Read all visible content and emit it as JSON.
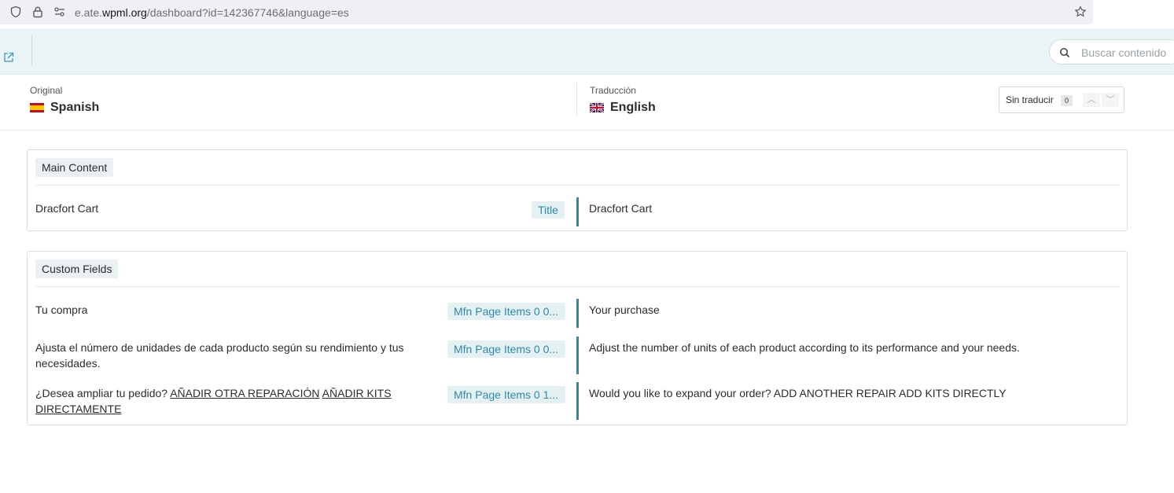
{
  "browser": {
    "url_prefix": "e.ate.",
    "url_domain": "wpml.org",
    "url_suffix": "/dashboard?id=142367746&language=es"
  },
  "toolbar": {
    "search_placeholder": "Buscar contenido"
  },
  "languages": {
    "original_label": "Original",
    "original_name": "Spanish",
    "translation_label": "Traducción",
    "translation_name": "English",
    "filter_label": "Sin traducir",
    "filter_count": "0"
  },
  "sections": {
    "main": {
      "title": "Main Content",
      "rows": [
        {
          "source": "Dracfort Cart",
          "tag": "Title",
          "target": "Dracfort Cart"
        }
      ]
    },
    "custom": {
      "title": "Custom Fields",
      "rows": [
        {
          "source": "Tu compra",
          "tag": "Mfn Page Items 0 0...",
          "target": "Your purchase"
        },
        {
          "source": "Ajusta el número de unidades de cada producto según su rendimiento y tus necesidades.",
          "tag": "Mfn Page Items 0 0...",
          "target": "Adjust the number of units of each product according to its performance and your needs."
        },
        {
          "source_plain": "¿Desea ampliar tu pedido? ",
          "source_link1": "AÑADIR OTRA REPARACIÓN",
          "source_link2": "AÑADIR KITS DIRECTAMENTE",
          "tag": "Mfn Page Items 0 1...",
          "target": "Would you like to expand your order? ADD ANOTHER REPAIR ADD KITS DIRECTLY"
        }
      ]
    }
  },
  "colors": {
    "accent": "#3a8597",
    "tag_text": "#2e8aa8",
    "toolbar_bg": "#eaf3f6"
  }
}
